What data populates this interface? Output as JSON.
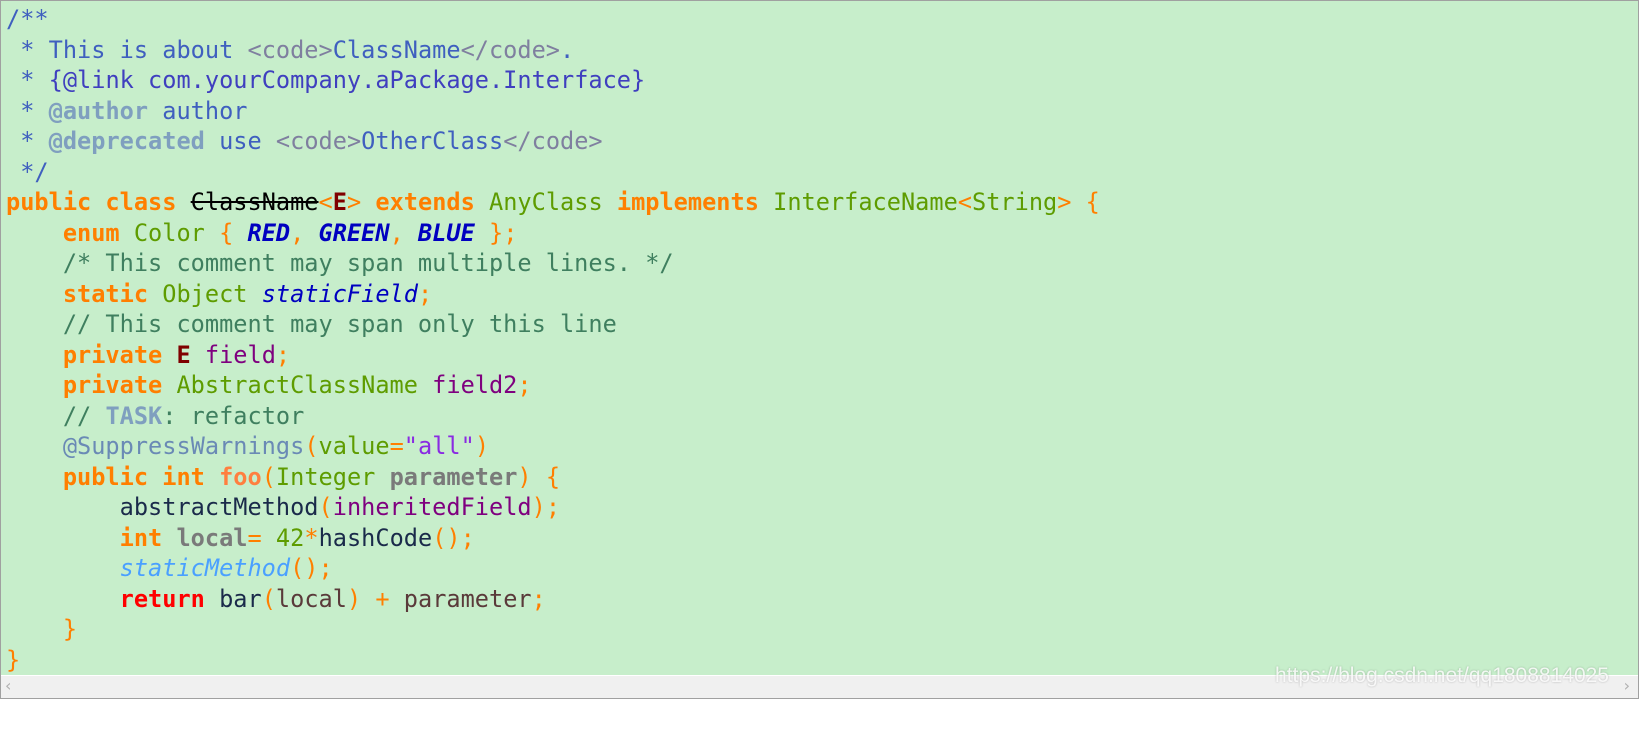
{
  "colors": {
    "background": "#c7eecb",
    "keyword": "#ff7f00",
    "comment": "#3f7f5f",
    "doc_comment": "#3f5fbf"
  },
  "code_lines": [
    [
      [
        "cd",
        "/**"
      ]
    ],
    [
      [
        "cd",
        " * This is about "
      ],
      [
        "ht",
        "<code>"
      ],
      [
        "cd",
        "ClassName"
      ],
      [
        "ht",
        "</code>"
      ],
      [
        "cd",
        "."
      ]
    ],
    [
      [
        "cd",
        " * "
      ],
      [
        "lk",
        "{@link com.yourCompany.aPackage.Interface}"
      ]
    ],
    [
      [
        "cd",
        " * "
      ],
      [
        "tg",
        "@author"
      ],
      [
        "cd",
        " author"
      ]
    ],
    [
      [
        "cd",
        " * "
      ],
      [
        "tg",
        "@deprecated"
      ],
      [
        "cd",
        " use "
      ],
      [
        "ht",
        "<code>"
      ],
      [
        "cd",
        "OtherClass"
      ],
      [
        "ht",
        "</code>"
      ]
    ],
    [
      [
        "cd",
        " */"
      ]
    ],
    [
      [
        "kw",
        "public class "
      ],
      [
        "dep",
        "ClassName"
      ],
      [
        "op",
        "<"
      ],
      [
        "tp",
        "E"
      ],
      [
        "op",
        "> "
      ],
      [
        "kw",
        "extends "
      ],
      [
        "ty",
        "AnyClass "
      ],
      [
        "kw",
        "implements "
      ],
      [
        "ty",
        "InterfaceName"
      ],
      [
        "op",
        "<"
      ],
      [
        "ty",
        "String"
      ],
      [
        "op",
        "> {"
      ]
    ],
    [
      [
        "kw",
        "    enum "
      ],
      [
        "ty",
        "Color "
      ],
      [
        "op",
        "{ "
      ],
      [
        "ec",
        "RED"
      ],
      [
        "op",
        ", "
      ],
      [
        "ec",
        "GREEN"
      ],
      [
        "op",
        ", "
      ],
      [
        "ec",
        "BLUE"
      ],
      [
        "op",
        " };"
      ]
    ],
    [
      [
        "cm",
        "    /* This comment may span multiple lines. */"
      ]
    ],
    [
      [
        "kw",
        "    static "
      ],
      [
        "ty",
        "Object "
      ],
      [
        "sf",
        "staticField"
      ],
      [
        "op",
        ";"
      ]
    ],
    [
      [
        "cm",
        "    // This comment may span only this line"
      ]
    ],
    [
      [
        "kw",
        "    private "
      ],
      [
        "tp",
        "E "
      ],
      [
        "fd",
        "field"
      ],
      [
        "op",
        ";"
      ]
    ],
    [
      [
        "kw",
        "    private "
      ],
      [
        "ty",
        "AbstractClassName "
      ],
      [
        "fd",
        "field2"
      ],
      [
        "op",
        ";"
      ]
    ],
    [
      [
        "cm",
        "    // "
      ],
      [
        "tg",
        "TASK"
      ],
      [
        "cm",
        ": refactor"
      ]
    ],
    [
      [
        "an",
        "    @SuppressWarnings"
      ],
      [
        "op",
        "("
      ],
      [
        "av",
        "value"
      ],
      [
        "op",
        "="
      ],
      [
        "st",
        "\"all\""
      ],
      [
        "op",
        ")"
      ]
    ],
    [
      [
        "kw",
        "    public int "
      ],
      [
        "fn",
        "foo"
      ],
      [
        "op",
        "("
      ],
      [
        "ty",
        "Integer "
      ],
      [
        "pm",
        "parameter"
      ],
      [
        "op",
        ") {"
      ]
    ],
    [
      [
        "mc",
        "        abstractMethod"
      ],
      [
        "op",
        "("
      ],
      [
        "fd",
        "inheritedField"
      ],
      [
        "op",
        ");"
      ]
    ],
    [
      [
        "kw",
        "        int "
      ],
      [
        "lv",
        "local"
      ],
      [
        "op",
        "= "
      ],
      [
        "nm",
        "42"
      ],
      [
        "op",
        "*"
      ],
      [
        "mc",
        "hashCode"
      ],
      [
        "op",
        "();"
      ]
    ],
    [
      [
        "sm",
        "        staticMethod"
      ],
      [
        "op",
        "();"
      ]
    ],
    [
      [
        "rt",
        "        return "
      ],
      [
        "mc",
        "bar"
      ],
      [
        "op",
        "("
      ],
      [
        "pl",
        "local"
      ],
      [
        "op",
        ") + "
      ],
      [
        "pl",
        "parameter"
      ],
      [
        "op",
        ";"
      ]
    ],
    [
      [
        "op",
        "    }"
      ]
    ],
    [
      [
        "op",
        "}"
      ]
    ]
  ],
  "scrollbar": {
    "left_arrow": "‹",
    "right_arrow": "›"
  },
  "watermark": "https://blog.csdn.net/qq1808814025"
}
